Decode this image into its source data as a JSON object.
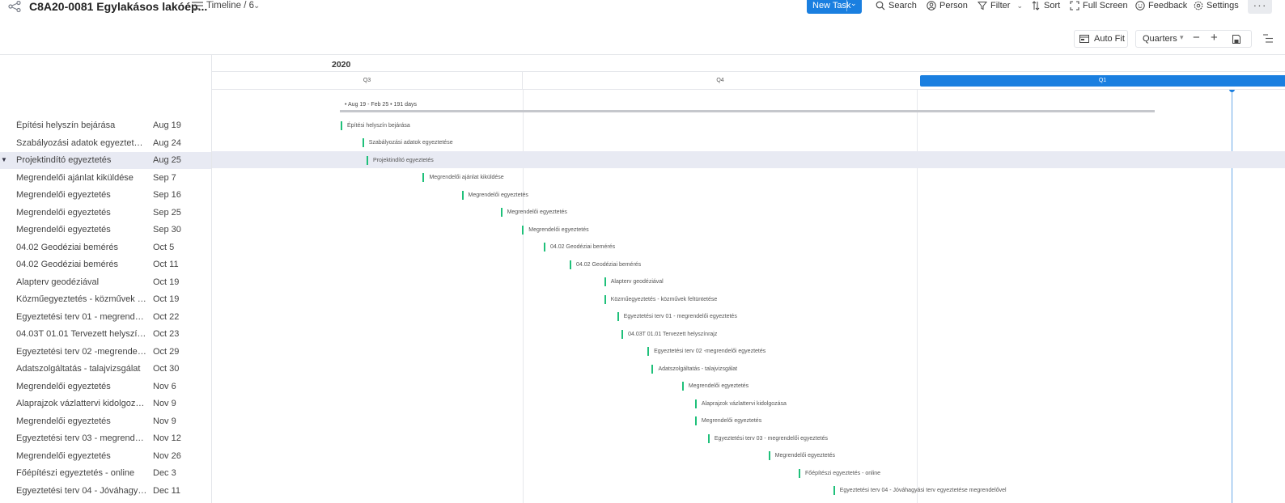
{
  "header": {
    "app_title": "C8A20-0081 Egylakásos lakóép...",
    "view_name": "Timeline / 6",
    "new_task_label": "New Task",
    "search_label": "Search",
    "person_label": "Person",
    "filter_label": "Filter",
    "sort_label": "Sort",
    "fullscreen_label": "Full Screen",
    "feedback_label": "Feedback",
    "settings_label": "Settings",
    "more_label": "···"
  },
  "toolbar": {
    "autofit_label": "Auto Fit",
    "scale_label": "Quarters",
    "minus_label": "−",
    "plus_label": "+"
  },
  "timeline": {
    "year": "2020",
    "quarters": [
      {
        "label": "Q3"
      },
      {
        "label": "Q4"
      },
      {
        "label": "Q1",
        "current": true
      }
    ],
    "summary": "• Aug 19 - Feb 25 • 191 days"
  },
  "colors": {
    "accent": "#1a7fe0",
    "task_bar": "#1fc07a",
    "selected_row": "#e8eaf3"
  },
  "tasks": [
    {
      "name": "Építési helyszín bejárása",
      "date": "Aug 19",
      "label": "Építési helyszín bejárása",
      "day": 231
    },
    {
      "name": "Szabályozási adatok egyeztetése",
      "date": "Aug 24",
      "label": "Szabályozási adatok egyeztetése",
      "day": 236
    },
    {
      "name": "Projektindító egyeztetés",
      "date": "Aug 25",
      "label": "Projektindító egyeztetés",
      "day": 237,
      "selected": true
    },
    {
      "name": "Megrendelői ajánlat kiküldése",
      "date": "Sep 7",
      "label": "Megrendelői ajánlat kiküldése",
      "day": 250
    },
    {
      "name": "Megrendelői egyeztetés",
      "date": "Sep 16",
      "label": "Megrendelői egyeztetés",
      "day": 259
    },
    {
      "name": "Megrendelői egyeztetés",
      "date": "Sep 25",
      "label": "Megrendelői egyeztetés",
      "day": 268
    },
    {
      "name": "Megrendelői egyeztetés",
      "date": "Sep 30",
      "label": "Megrendelői egyeztetés",
      "day": 273
    },
    {
      "name": "04.02 Geodéziai bemérés",
      "date": "Oct 5",
      "label": "04.02 Geodéziai bemérés",
      "day": 278
    },
    {
      "name": "04.02 Geodéziai bemérés",
      "date": "Oct 11",
      "label": "04.02 Geodéziai bemérés",
      "day": 284
    },
    {
      "name": "Alapterv geodéziával",
      "date": "Oct 19",
      "label": "Alapterv geodéziával",
      "day": 292
    },
    {
      "name": "Közműegyeztetés - közművek feltüntet...",
      "date": "Oct 19",
      "label": "Közműegyeztetés - közművek feltüntetése",
      "day": 292
    },
    {
      "name": "Egyeztetési terv 01 - megrendelői egye...",
      "date": "Oct 22",
      "label": "Egyeztetési terv 01 - megrendelői egyeztetés",
      "day": 295
    },
    {
      "name": "04.03T 01.01 Tervezett helyszínrajz",
      "date": "Oct 23",
      "label": "04.03T 01.01 Tervezett helyszínrajz",
      "day": 296
    },
    {
      "name": "Egyeztetési terv 02 -megrendelői egyez...",
      "date": "Oct 29",
      "label": "Egyeztetési terv 02 -megrendelői egyeztetés",
      "day": 302
    },
    {
      "name": "Adatszolgáltatás - talajvizsgálat",
      "date": "Oct 30",
      "label": "Adatszolgáltatás - talajvizsgálat",
      "day": 303
    },
    {
      "name": "Megrendelői egyeztetés",
      "date": "Nov 6",
      "label": "Megrendelői egyeztetés",
      "day": 310
    },
    {
      "name": "Alaprajzok vázlattervi kidolgozása",
      "date": "Nov 9",
      "label": "Alaprajzok vázlattervi kidolgozása",
      "day": 313
    },
    {
      "name": "Megrendelői egyeztetés",
      "date": "Nov 9",
      "label": "Megrendelői egyeztetés",
      "day": 313
    },
    {
      "name": "Egyeztetési terv 03 - megrendelői egye...",
      "date": "Nov 12",
      "label": "Egyeztetési terv 03 - megrendelői egyeztetés",
      "day": 316
    },
    {
      "name": "Megrendelői egyeztetés",
      "date": "Nov 26",
      "label": "Megrendelői egyeztetés",
      "day": 330
    },
    {
      "name": "Főépítészi egyeztetés - online",
      "date": "Dec 3",
      "label": "Főépítészi egyeztetés - online",
      "day": 337
    },
    {
      "name": "Egyeztetési terv 04 - Jóváhagyási terv ...",
      "date": "Dec 11",
      "label": "Egyeztetési terv 04 - Jóváhagyási terv egyeztetése megrendelővel",
      "day": 345
    }
  ]
}
